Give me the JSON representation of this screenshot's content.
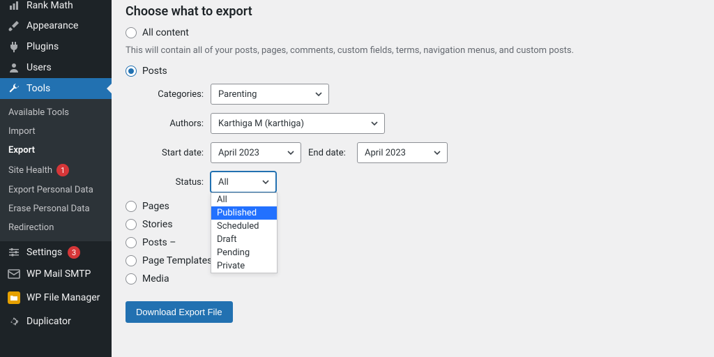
{
  "sidebar": {
    "top_cut": "Rank Math",
    "items": [
      {
        "label": "Appearance",
        "icon": "brush"
      },
      {
        "label": "Plugins",
        "icon": "plug"
      },
      {
        "label": "Users",
        "icon": "user"
      },
      {
        "label": "Tools",
        "icon": "wrench",
        "active": true
      }
    ],
    "tools_submenu": [
      {
        "label": "Available Tools"
      },
      {
        "label": "Import"
      },
      {
        "label": "Export",
        "current": true
      },
      {
        "label": "Site Health",
        "badge": "1"
      },
      {
        "label": "Export Personal Data"
      },
      {
        "label": "Erase Personal Data"
      },
      {
        "label": "Redirection"
      }
    ],
    "bottom": [
      {
        "label": "Settings",
        "icon": "sliders",
        "badge": "3"
      },
      {
        "label": "WP Mail SMTP",
        "icon": "mail"
      },
      {
        "label": "WP File Manager",
        "icon": "folder-yellow"
      },
      {
        "label": "Duplicator",
        "icon": "gear"
      }
    ]
  },
  "main": {
    "heading": "Choose what to export",
    "all_content_label": "All content",
    "all_content_desc": "This will contain all of your posts, pages, comments, custom fields, terms, navigation menus, and custom posts.",
    "options": {
      "posts": "Posts",
      "pages": "Pages",
      "stories": "Stories",
      "posts_blocks": "Posts –",
      "page_templates": "Page Templates",
      "media": "Media"
    },
    "filters": {
      "categories": {
        "label": "Categories:",
        "value": "Parenting"
      },
      "authors": {
        "label": "Authors:",
        "value": "Karthiga M (karthiga)"
      },
      "start_date": {
        "label": "Start date:",
        "value": "April 2023"
      },
      "end_date": {
        "label": "End date:",
        "value": "April 2023"
      },
      "status": {
        "label": "Status:",
        "value": "All"
      }
    },
    "status_options": [
      "All",
      "Published",
      "Scheduled",
      "Draft",
      "Pending",
      "Private"
    ],
    "status_highlight": "Published",
    "download_button": "Download Export File"
  }
}
